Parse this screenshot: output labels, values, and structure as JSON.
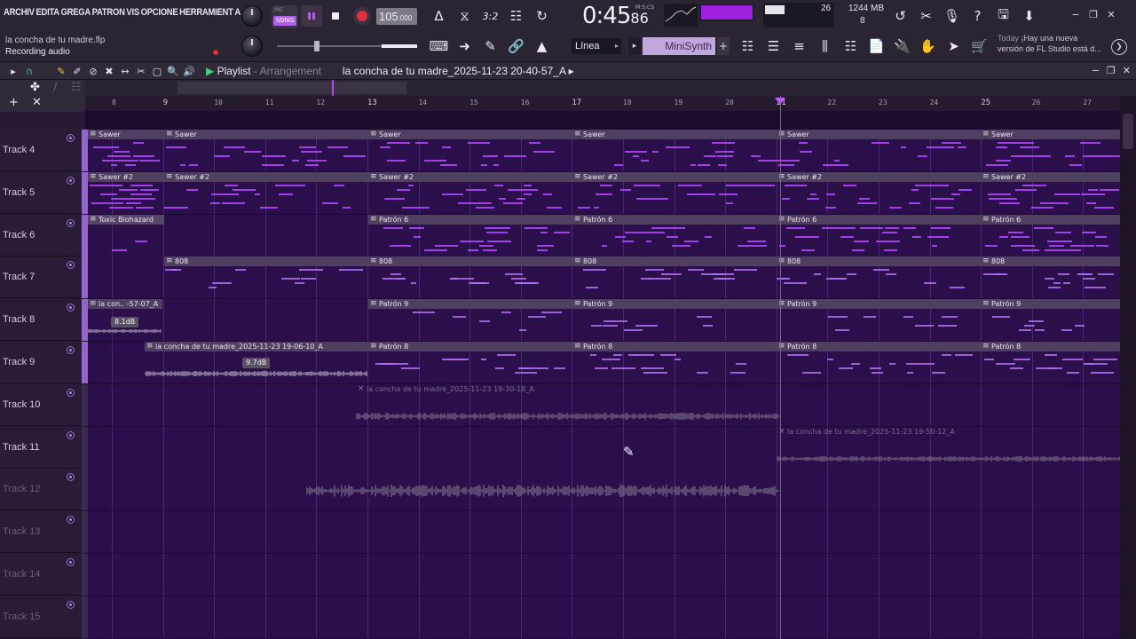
{
  "menu": [
    "ARCHIV",
    "EDITA",
    "GREGA",
    "PATRON",
    "VIS",
    "OPCIONE",
    "HERRAMIENT",
    "A"
  ],
  "project": {
    "file_name": "la concha de tu madre.flp",
    "status": "Recording audio"
  },
  "transport": {
    "mode_pat": "PAT",
    "mode_song": "SONG",
    "tempo_int": "105",
    "tempo_frac": ".000",
    "time_main": "0:45",
    "time_frac": "86",
    "time_label": "M:S:CS"
  },
  "monitor": {
    "cpu": "26",
    "memory": "1244 MB",
    "polyphony": "8"
  },
  "snap": "Línea",
  "plugin_picker": "MiniSynth",
  "news": {
    "today": "Today",
    "line1": "¡Hay una nueva",
    "line2": "versión de FL Studio está d..."
  },
  "playlist": {
    "title": "Playlist",
    "separator": " - ",
    "view": "Arrangement",
    "arrangement_file": "la concha de tu madre_2025-11-23 20-40-57_A",
    "arrow": "▸"
  },
  "ruler": {
    "bars": [
      "8",
      "9",
      "10",
      "11",
      "12",
      "13",
      "14",
      "15",
      "16",
      "17",
      "18",
      "19",
      "20",
      "21",
      "22",
      "23",
      "24",
      "25",
      "26",
      "27"
    ]
  },
  "tracks": [
    {
      "name": "Track 4",
      "dim": false
    },
    {
      "name": "Track 5",
      "dim": false
    },
    {
      "name": "Track 6",
      "dim": false
    },
    {
      "name": "Track 7",
      "dim": false
    },
    {
      "name": "Track 8",
      "dim": false
    },
    {
      "name": "Track 9",
      "dim": false
    },
    {
      "name": "Track 10",
      "dim": false
    },
    {
      "name": "Track 11",
      "dim": false
    },
    {
      "name": "Track 12",
      "dim": true
    },
    {
      "name": "Track 13",
      "dim": true
    },
    {
      "name": "Track 14",
      "dim": true
    },
    {
      "name": "Track 15",
      "dim": true
    }
  ],
  "clips": {
    "sawer": "Sawer",
    "sawer2": "Sawer #2",
    "toxic": "Toxic Biohazard",
    "patron6": "Patrón 6",
    "b808": "808",
    "patron9": "Patrón 9",
    "patron8": "Patrón 8",
    "audio_short": "la con.. -57-07_A",
    "audio_t9": "la concha de tu madre_2025-11-23 19-06-10_A",
    "audio_t10": "la concha de tu madre_2025-11-23 19-30-18_A",
    "audio_t11": "la concha de tu madre_2025-11-23 19-50-12_A",
    "db_t8": "8.1dB",
    "db_t9": "9.7dB"
  },
  "colors": {
    "accent": "#b25ee8",
    "lane_bg": "#2a0f4a",
    "note": "#a040e8",
    "clip_header": "#4f3f60",
    "record": "#e0303a"
  }
}
